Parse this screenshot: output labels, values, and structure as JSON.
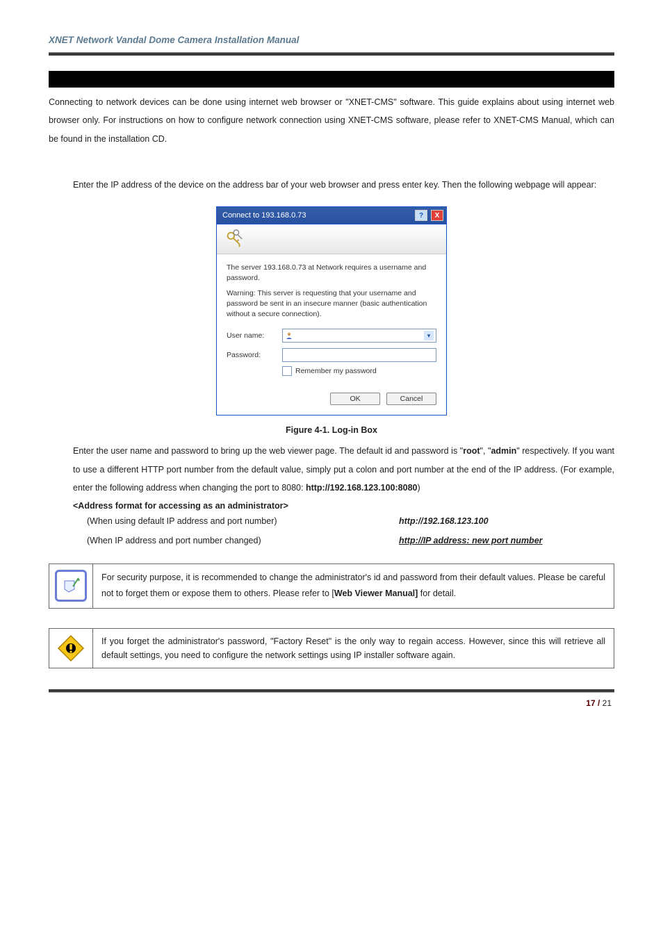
{
  "header": {
    "title": "XNET Network Vandal Dome Camera Installation Manual"
  },
  "intro": "Connecting to network devices can be done using internet web browser or \"XNET-CMS\" software.   This guide explains about using internet web browser only. For instructions on how to configure network connection using XNET-CMS software, please refer to XNET-CMS Manual, which can be found in the installation CD.",
  "section1": "Enter the IP address of the device on the address bar of your web browser and press enter key. Then the following webpage will appear:",
  "dialog": {
    "title": "Connect to 193.168.0.73",
    "msg1": "The server 193.168.0.73 at Network requires a username and password.",
    "msg2": "Warning: This server is requesting that your username and password be sent in an insecure manner (basic authentication without a secure connection).",
    "user_label": "User name:",
    "pass_label": "Password:",
    "remember": "Remember my password",
    "ok": "OK",
    "cancel": "Cancel"
  },
  "figure_caption": "Figure 4-1. Log-in Box",
  "after1": "Enter the user name and password to bring up the web viewer page. The default id and password is \"",
  "after_root": "root",
  "after_mid": "\", \"",
  "after_admin": "admin",
  "after2": "\" respectively. If you want to use a different HTTP port number from the default value, simply put a colon and port number at the end of the IP address. (For example, enter the following address when changing the port to 8080: ",
  "example_addr": "http://192.168.123.100:8080",
  "after3": ")",
  "addr_header": "<Address format for accessing as an administrator>",
  "addr_row1_left": "(When using default IP address and port number)",
  "addr_row1_right": "http://192.168.123.100",
  "addr_row2_left": "(When IP address and port number changed)",
  "addr_row2_right_a": "http://IP",
  "addr_row2_right_b": " address: new port number",
  "callout1_a": "For security purpose, it is recommended to change the administrator's id and password from their default values. Please be careful not to forget them or expose them to others. Please refer to [",
  "callout1_b": "Web Viewer Manual]",
  "callout1_c": " for detail.",
  "callout2": "If you forget the administrator's password, \"Factory Reset\" is the only way to regain access. However, since this will retrieve all default settings, you need to configure the network settings using IP installer software again.",
  "footer": {
    "page_bold": "17 / ",
    "total": "21"
  }
}
